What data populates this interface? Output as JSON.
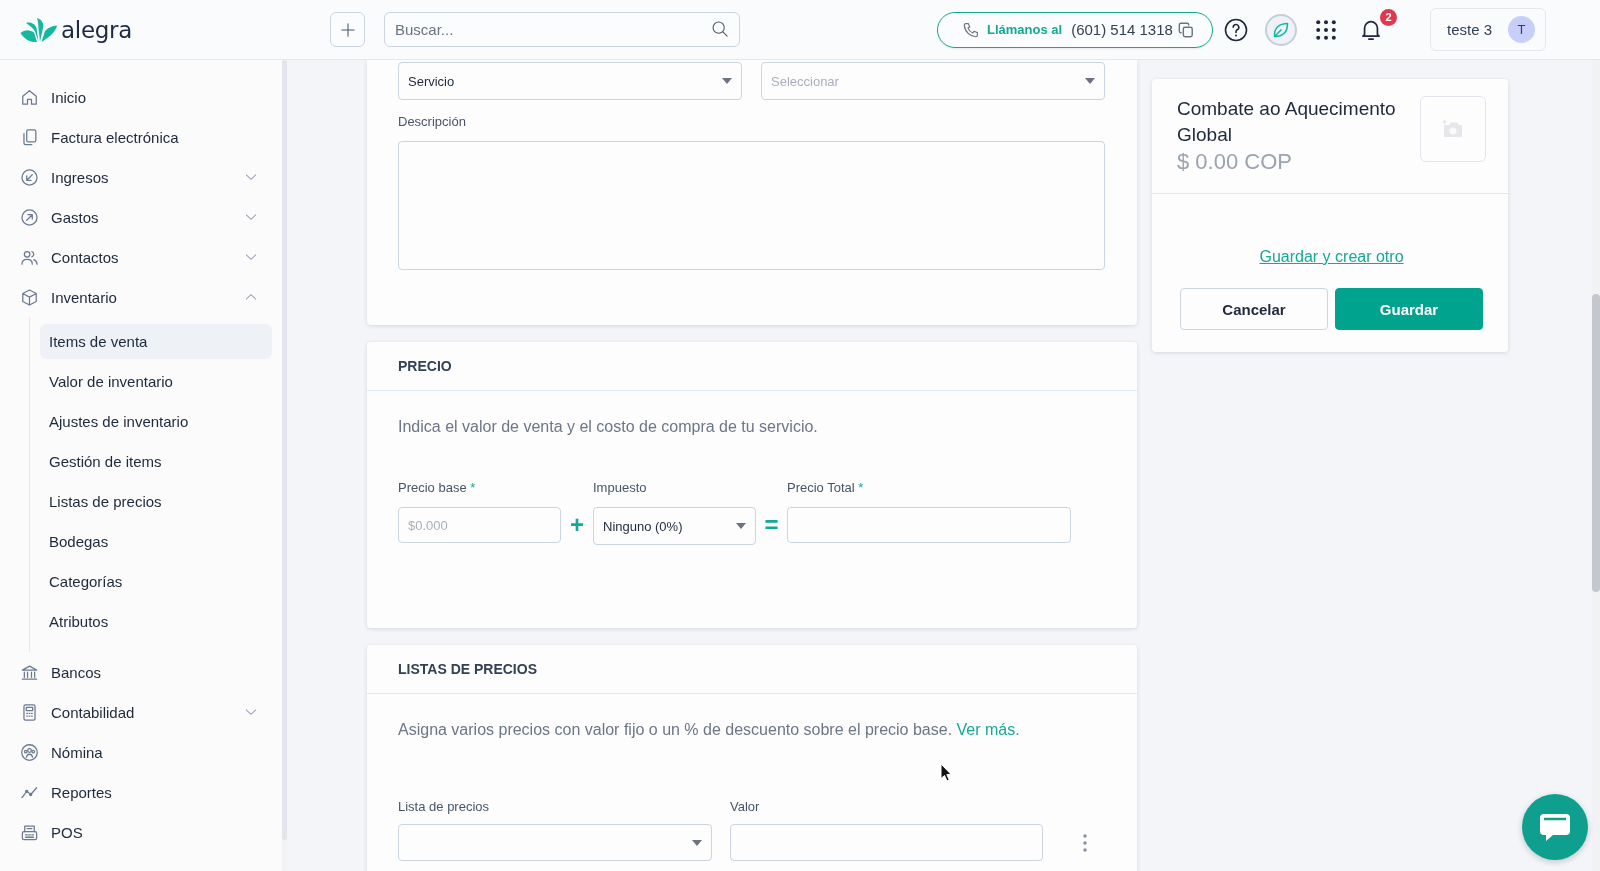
{
  "header": {
    "logo_text": "alegra",
    "search": {
      "placeholder": "Buscar..."
    },
    "call": {
      "label": "Llámanos al",
      "number": "(601) 514 1318"
    },
    "notifications": {
      "count": "2"
    },
    "user": {
      "name": "teste 3",
      "initial": "T"
    }
  },
  "sidebar": {
    "items": [
      {
        "kind": "link",
        "label": "Inicio",
        "selected": false
      },
      {
        "kind": "link",
        "label": "Factura electrónica",
        "selected": false
      },
      {
        "kind": "group",
        "label": "Ingresos",
        "selected": false,
        "expanded": false
      },
      {
        "kind": "group",
        "label": "Gastos",
        "selected": false,
        "expanded": false
      },
      {
        "kind": "group",
        "label": "Contactos",
        "selected": false,
        "expanded": false
      },
      {
        "kind": "group",
        "label": "Inventario",
        "selected": false,
        "expanded": true,
        "children": [
          {
            "label": "Items de venta",
            "selected": true
          },
          {
            "label": "Valor de inventario",
            "selected": false
          },
          {
            "label": "Ajustes de inventario",
            "selected": false
          },
          {
            "label": "Gestión de items",
            "selected": false
          },
          {
            "label": "Listas de precios",
            "selected": false
          },
          {
            "label": "Bodegas",
            "selected": false
          },
          {
            "label": "Categorías",
            "selected": false
          },
          {
            "label": "Atributos",
            "selected": false
          }
        ]
      },
      {
        "kind": "link",
        "label": "Bancos",
        "selected": false
      },
      {
        "kind": "group",
        "label": "Contabilidad",
        "selected": false,
        "expanded": false
      },
      {
        "kind": "link",
        "label": "Nómina",
        "selected": false
      },
      {
        "kind": "link",
        "label": "Reportes",
        "selected": false
      },
      {
        "kind": "link",
        "label": "POS",
        "selected": false
      }
    ]
  },
  "form": {
    "selects": [
      {
        "value": "Servicio"
      },
      {
        "placeholder": "Seleccionar"
      }
    ],
    "description": {
      "label": "Descripción"
    }
  },
  "price": {
    "title": "PRECIO",
    "description": "Indica el valor de venta y el costo de compra de tu servicio.",
    "fields": [
      {
        "kind": "input",
        "label": "Precio base",
        "required_mark": "*",
        "placeholder": "$0.000"
      },
      {
        "kind": "operator",
        "symbol": "+"
      },
      {
        "kind": "select",
        "label": "Impuesto",
        "value": "Ninguno (0%)"
      },
      {
        "kind": "operator",
        "symbol": "="
      },
      {
        "kind": "input",
        "label": "Precio Total",
        "required_mark": "*"
      }
    ]
  },
  "price_lists": {
    "title": "LISTAS DE PRECIOS",
    "description": "Asigna varios precios con valor fijo o un % de descuento sobre el precio base.",
    "link": "Ver más.",
    "fields": [
      {
        "kind": "select",
        "label": "Lista de precios"
      },
      {
        "kind": "input",
        "label": "Valor"
      }
    ]
  },
  "summary": {
    "title": "Combate ao Aquecimento Global",
    "price": "$ 0.00 COP",
    "link": "Guardar y crear otro",
    "buttons": [
      {
        "kind": "secondary",
        "label": "Cancelar"
      },
      {
        "kind": "primary",
        "label": "Guardar"
      }
    ]
  }
}
